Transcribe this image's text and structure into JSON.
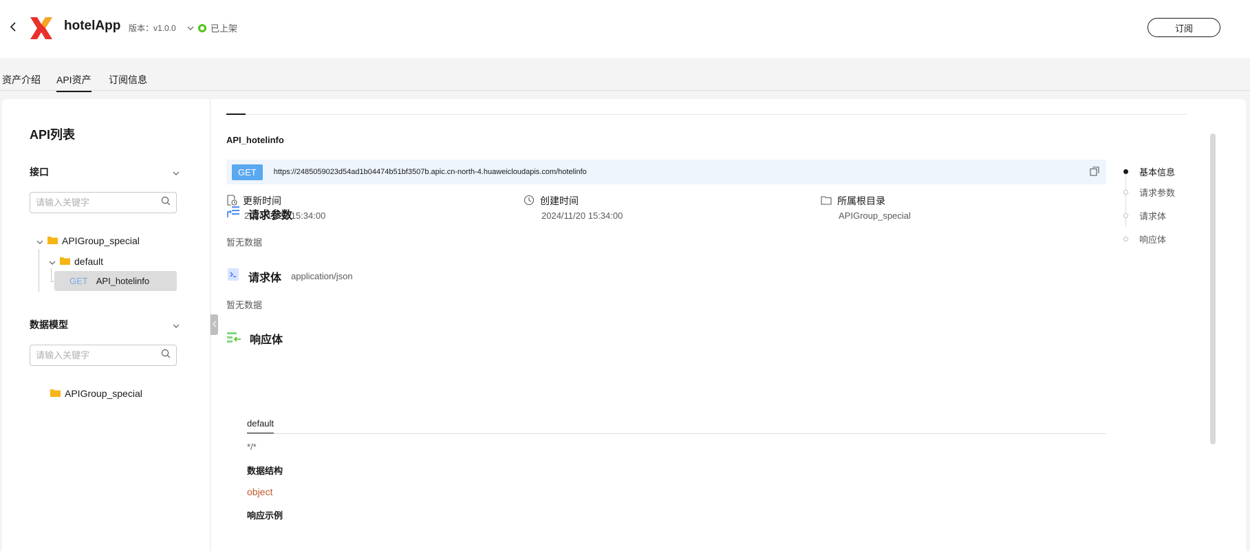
{
  "header": {
    "app_name": "hotelApp",
    "version_label": "版本：v1.0.0",
    "status": "已上架",
    "subscribe_label": "订阅",
    "colors": {
      "status": "#52c41a",
      "logo_red": "#e8302d",
      "logo_orange": "#f5a623"
    }
  },
  "tabs": [
    {
      "label": "资产介绍"
    },
    {
      "label": "API资产"
    },
    {
      "label": "订阅信息"
    }
  ],
  "sidebar": {
    "title": "API列表",
    "interfaces": {
      "label": "接口",
      "search_placeholder": "请输入关键字",
      "tree": {
        "group": "APIGroup_special",
        "folder": "default",
        "api_method": "GET",
        "api_name": "API_hotelinfo"
      }
    },
    "models": {
      "label": "数据模型",
      "search_placeholder": "请输入关键字",
      "group": "APIGroup_special"
    }
  },
  "content": {
    "api_name": "API_hotelinfo",
    "method": "GET",
    "url": "https://2485059023d54ad1b04474b51bf3507b.apic.cn-north-4.huaweicloudapis.com/hotelinfo",
    "meta": {
      "updated": {
        "label": "更新时间",
        "value": "2024/11/20 15:34:00"
      },
      "created": {
        "label": "创建时间",
        "value": "2024/11/20 15:34:00"
      },
      "root_dir": {
        "label": "所属根目录",
        "value": "APIGroup_special"
      }
    },
    "request_params": {
      "title": "请求参数",
      "empty": "暂无数据"
    },
    "request_body": {
      "title": "请求体",
      "content_type": "application/json",
      "empty": "暂无数据"
    },
    "response_body": {
      "title": "响应体",
      "tab": "default",
      "media": "*/*",
      "structure_label": "数据结构",
      "structure_value": "object",
      "example_label": "响应示例"
    }
  },
  "anchor": {
    "items": [
      {
        "label": "基本信息"
      },
      {
        "label": "请求参数"
      },
      {
        "label": "请求体"
      },
      {
        "label": "响应体"
      }
    ]
  }
}
